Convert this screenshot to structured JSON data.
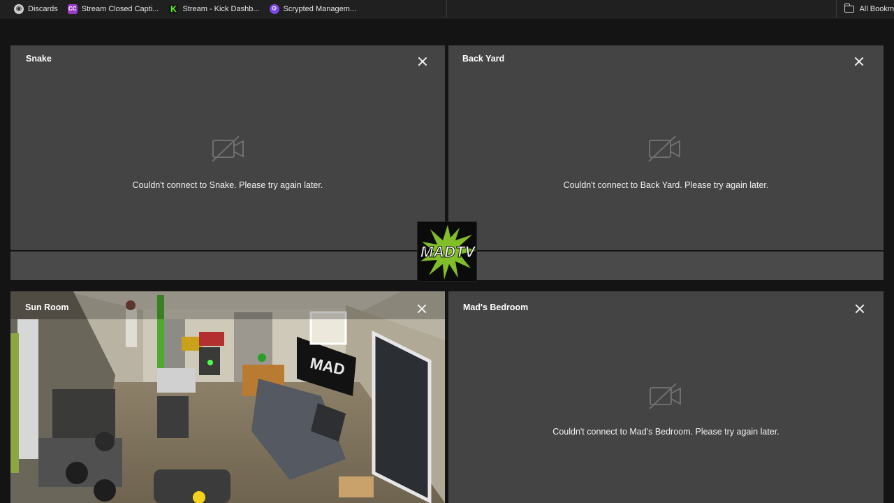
{
  "bookmarks": {
    "items": [
      {
        "label": "Discards",
        "icon": "globe-icon"
      },
      {
        "label": "Stream Closed Capti...",
        "icon": "closed-caption-icon"
      },
      {
        "label": "Stream - Kick Dashb...",
        "icon": "kick-icon"
      },
      {
        "label": "Scrypted Managem...",
        "icon": "scrypted-icon"
      }
    ],
    "all_bookmarks": "All Bookm"
  },
  "cameras": [
    {
      "name": "Snake",
      "status": "Couldn't connect to Snake. Please try again later.",
      "connected": false
    },
    {
      "name": "Back Yard",
      "status": "Couldn't connect to Back Yard. Please try again later.",
      "connected": false
    },
    {
      "name": "Sun Room",
      "status": "",
      "connected": true
    },
    {
      "name": "Mad's Bedroom",
      "status": "Couldn't connect to Mad's Bedroom. Please try again later.",
      "connected": false
    }
  ],
  "logo": {
    "text": "MADTV",
    "accent": "#8fd12a"
  },
  "colors": {
    "panel": "#444444",
    "background": "#141414",
    "text": "#f0f0f0"
  }
}
